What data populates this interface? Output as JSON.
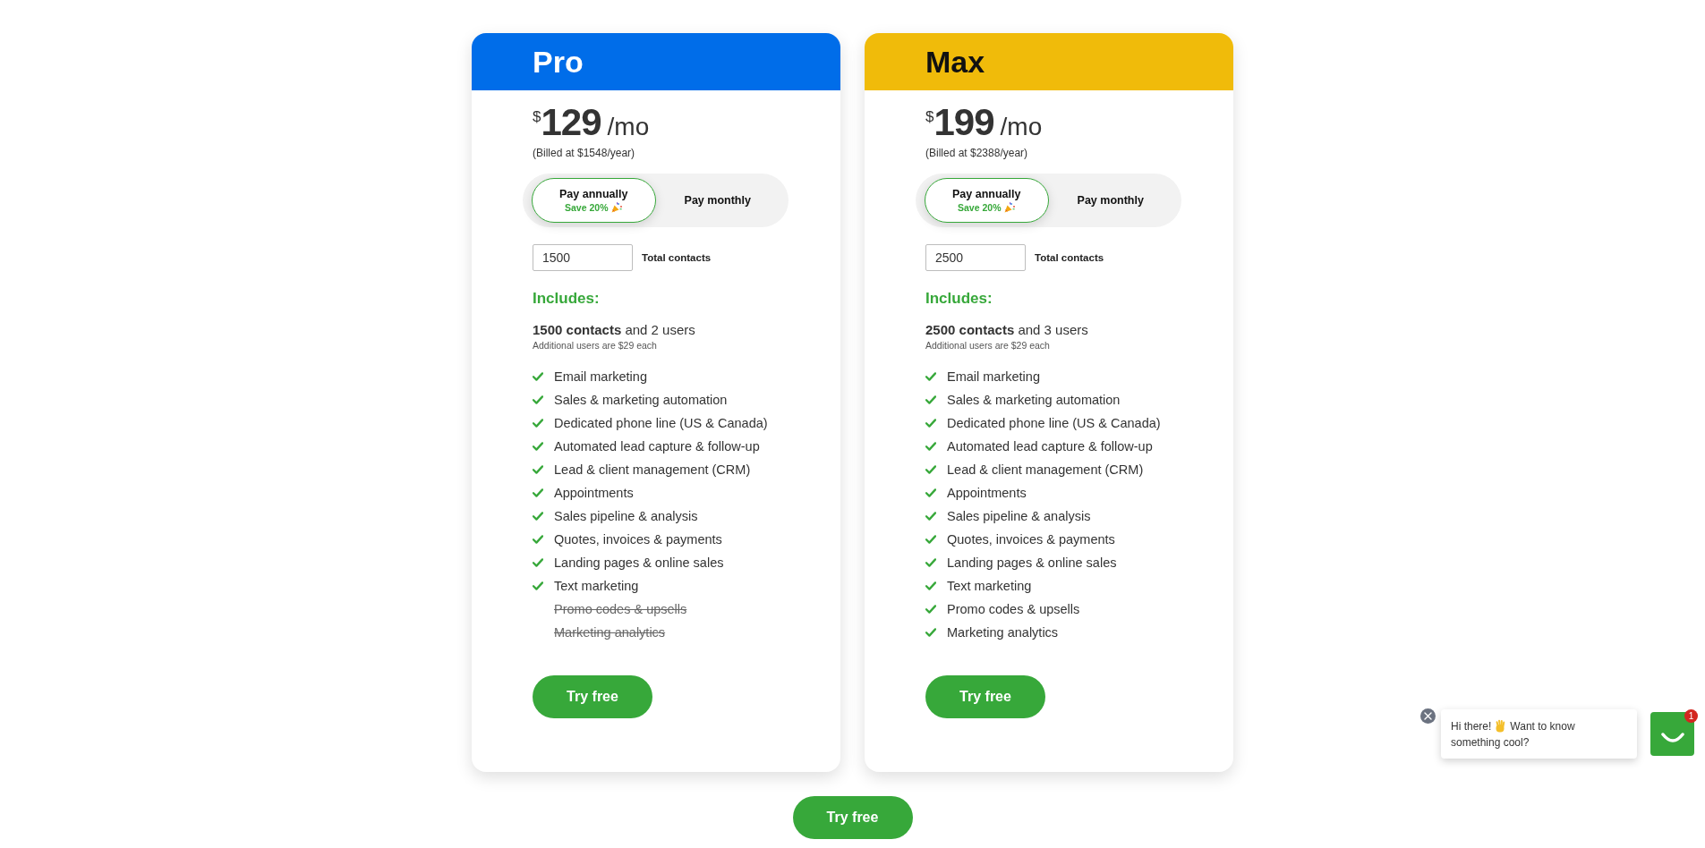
{
  "plans": [
    {
      "name": "Pro",
      "color": "#006de9",
      "price": {
        "currency": "$",
        "amount": "129",
        "period": "/mo"
      },
      "billed": "(Billed at $1548/year)",
      "billing_options": [
        {
          "label": "Pay annually",
          "note": "Save 20%",
          "selected": true
        },
        {
          "label": "Pay monthly",
          "selected": false
        }
      ],
      "contacts": {
        "value": "1500",
        "label": "Total contacts"
      },
      "includes": {
        "heading": "Includes:",
        "summary": "**1500 contacts** and 2 users",
        "note": "Additional users are $29 each",
        "features": [
          {
            "label": "Email marketing",
            "included": true
          },
          {
            "label": "Sales & marketing automation",
            "included": true
          },
          {
            "label": "Dedicated phone line (US & Canada)",
            "included": true
          },
          {
            "label": "Automated lead capture & follow-up",
            "included": true
          },
          {
            "label": "Lead & client management (CRM)",
            "included": true
          },
          {
            "label": "Appointments",
            "included": true
          },
          {
            "label": "Sales pipeline & analysis",
            "included": true
          },
          {
            "label": "Quotes, invoices & payments",
            "included": true
          },
          {
            "label": "Landing pages & online sales",
            "included": true
          },
          {
            "label": "Text marketing",
            "included": true
          },
          {
            "label": "Promo codes & upsells",
            "included": false
          },
          {
            "label": "Marketing analytics",
            "included": false
          }
        ]
      },
      "cta": "Try free"
    },
    {
      "name": "Max",
      "color": "#f0bb0a",
      "price": {
        "currency": "$",
        "amount": "199",
        "period": "/mo"
      },
      "billed": "(Billed at $2388/year)",
      "billing_options": [
        {
          "label": "Pay annually",
          "note": "Save 20%",
          "selected": true
        },
        {
          "label": "Pay monthly",
          "selected": false
        }
      ],
      "contacts": {
        "value": "2500",
        "label": "Total contacts"
      },
      "includes": {
        "heading": "Includes:",
        "summary": "**2500 contacts** and 3 users",
        "note": "Additional users are $29 each",
        "features": [
          {
            "label": "Email marketing",
            "included": true
          },
          {
            "label": "Sales & marketing automation",
            "included": true
          },
          {
            "label": "Dedicated phone line (US & Canada)",
            "included": true
          },
          {
            "label": "Automated lead capture & follow-up",
            "included": true
          },
          {
            "label": "Lead & client management (CRM)",
            "included": true
          },
          {
            "label": "Appointments",
            "included": true
          },
          {
            "label": "Sales pipeline & analysis",
            "included": true
          },
          {
            "label": "Quotes, invoices & payments",
            "included": true
          },
          {
            "label": "Landing pages & online sales",
            "included": true
          },
          {
            "label": "Text marketing",
            "included": true
          },
          {
            "label": "Promo codes & upsells",
            "included": true
          },
          {
            "label": "Marketing analytics",
            "included": true
          }
        ]
      },
      "cta": "Try free"
    }
  ],
  "cta": "Try free",
  "chat": {
    "greeting": "Hi there!",
    "message_lines": [
      "Want to know",
      "something cool?"
    ],
    "badge": "1"
  }
}
